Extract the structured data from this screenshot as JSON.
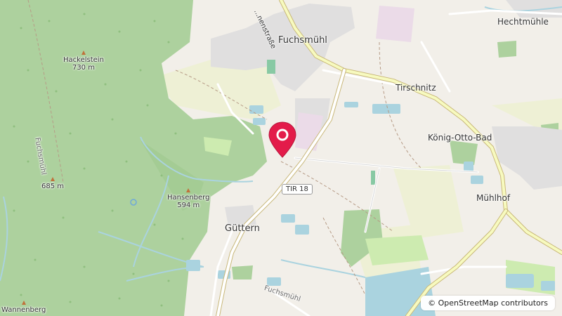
{
  "map": {
    "places": {
      "fuchsmuehl": "Fuchsmühl",
      "tirschnitz": "Tirschnitz",
      "koenig_otto_bad": "König-Otto-Bad",
      "muehlhof": "Mühlhof",
      "guettern": "Güttern",
      "hechtmuehle": "Hechtmühle"
    },
    "peaks": {
      "hackelstein_name": "Hackelstein",
      "hackelstein_elev": "730 m",
      "hansenberg_name": "Hansenberg",
      "hansenberg_elev": "594 m",
      "unnamed_elev": "685 m",
      "wannenberg_name": "Wannenberg"
    },
    "streams": {
      "fuchsmuehl_west": "Fuchsmühl",
      "fuchsmuehl_south": "Fuchsmühl"
    },
    "streets": {
      "north_street": "...nenstraße"
    },
    "road_ref": "TIR 18",
    "marker_icon": "location-pin-icon",
    "attribution": "© OpenStreetMap contributors",
    "colors": {
      "forest": "#add19e",
      "meadow": "#cdebb0",
      "farmland": "#eef0d5",
      "water": "#aad3df",
      "residential": "#e0dfdf",
      "road_major": "#f7fabf",
      "marker": "#e31b4a"
    }
  }
}
